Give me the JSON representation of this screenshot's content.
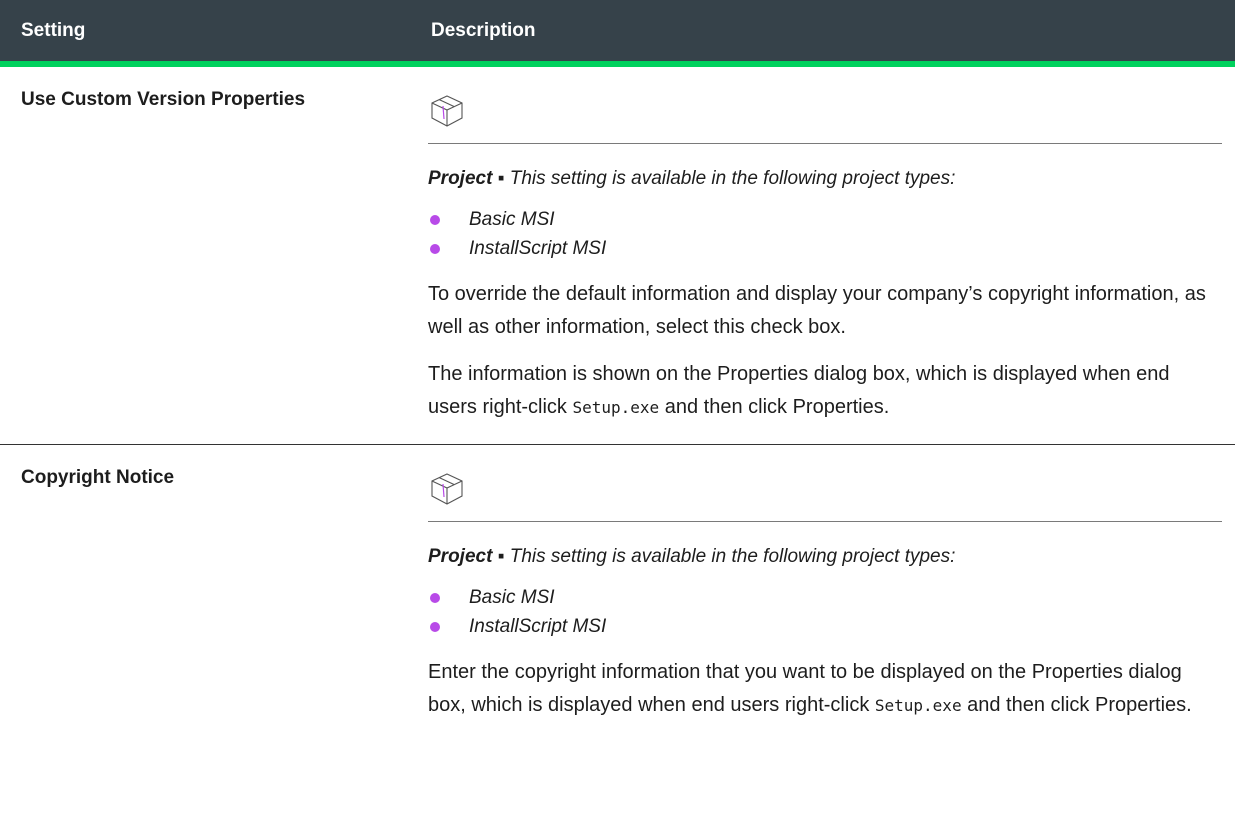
{
  "header": {
    "setting": "Setting",
    "description": "Description"
  },
  "rows": [
    {
      "setting": "Use Custom Version Properties",
      "icon": "project-box-icon",
      "project_label": "Project",
      "project_separator": " ▪ ",
      "project_text": "This setting is available in the following project types:",
      "project_types": [
        "Basic MSI",
        "InstallScript MSI"
      ],
      "para1": "To override the default information and display your company’s copyright information, as well as other information, select this check box.",
      "para2_a": "The information is shown on the Properties dialog box, which is displayed when end users right-click ",
      "para2_code": "Setup.exe",
      "para2_b": " and then click Properties."
    },
    {
      "setting": "Copyright Notice",
      "icon": "project-box-icon",
      "project_label": "Project",
      "project_separator": " ▪ ",
      "project_text": "This setting is available in the following project types:",
      "project_types": [
        "Basic MSI",
        "InstallScript MSI"
      ],
      "para1_a": "Enter the copyright information that you want to be displayed on the Properties dialog box, which is displayed when end users right-click ",
      "para1_code": "Setup.exe",
      "para1_b": " and then click Properties."
    }
  ],
  "colors": {
    "header_bg": "#36424a",
    "header_rule": "#00d15d",
    "bullet": "#b84ae8"
  }
}
